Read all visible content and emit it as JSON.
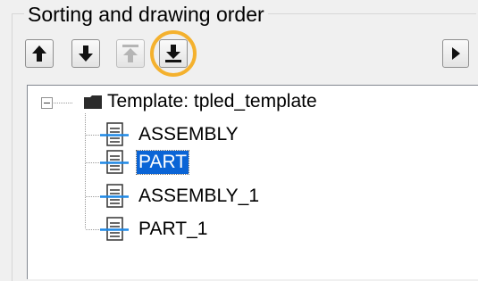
{
  "group": {
    "title": "Sorting and drawing order"
  },
  "toolbar": {
    "buttons": [
      {
        "name": "move-up",
        "icon": "arrow-up-icon",
        "enabled": true
      },
      {
        "name": "move-down",
        "icon": "arrow-down-icon",
        "enabled": true
      },
      {
        "name": "move-to-top",
        "icon": "arrow-to-top-icon",
        "enabled": false
      },
      {
        "name": "move-to-bottom",
        "icon": "arrow-to-bottom-icon",
        "enabled": true,
        "highlighted": true
      },
      {
        "name": "expand-right",
        "icon": "triangle-right-icon",
        "enabled": true
      }
    ],
    "highlight_color": "#f4b12e"
  },
  "tree": {
    "root": {
      "label": "Template: tpled_template",
      "expanded": true,
      "icon": "folder-icon"
    },
    "children": [
      {
        "label": "ASSEMBLY",
        "selected": false,
        "icon": "document-icon"
      },
      {
        "label": "PART",
        "selected": true,
        "icon": "document-icon"
      },
      {
        "label": "ASSEMBLY_1",
        "selected": false,
        "icon": "document-icon"
      },
      {
        "label": "PART_1",
        "selected": false,
        "icon": "document-icon"
      }
    ],
    "selection_color": "#0a64d6"
  }
}
